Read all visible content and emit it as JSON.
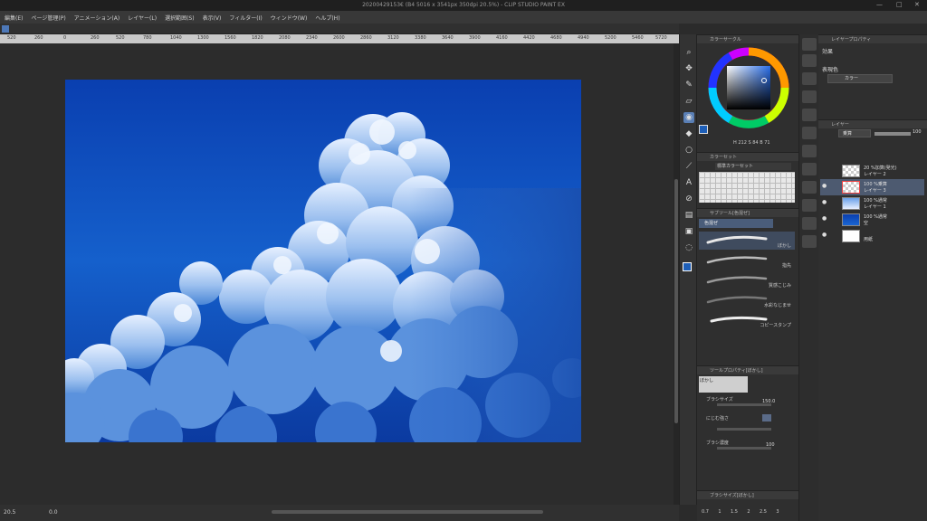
{
  "app": {
    "title": "20200429153€ (B4 5016 x 3541px 350dpi 20.5%) - CLIP STUDIO PAINT EX"
  },
  "window_controls": {
    "minimize": "—",
    "maximize": "□",
    "close": "✕"
  },
  "menu": [
    "編集(E)",
    "ページ管理(P)",
    "アニメーション(A)",
    "レイヤー(L)",
    "選択範囲(S)",
    "表示(V)",
    "フィルター(I)",
    "ウィンドウ(W)",
    "ヘルプ(H)"
  ],
  "ruler": {
    "ticks": [
      "520",
      "260",
      "0",
      "260",
      "520",
      "780",
      "1040",
      "1300",
      "1560",
      "1820",
      "2080",
      "2340",
      "2600",
      "2860",
      "3120",
      "3380",
      "3640",
      "3900",
      "4160",
      "4420",
      "4680",
      "4940",
      "5200",
      "5460",
      "5720"
    ]
  },
  "status": {
    "zoom": "20.5",
    "angle": "0.0"
  },
  "color_wheel": {
    "panel_title": "カラーサークル",
    "readout": "H 212  S 84  B 71",
    "main_color": "#1e5fb8",
    "sub_color": "#ffffff"
  },
  "color_set": {
    "panel_title": "カラーセット",
    "set_name": "標準カラーセット"
  },
  "sub_tool": {
    "panel_title": "サブツール[色混ぜ]",
    "group": "色混ぜ",
    "brushes": [
      "ぼかし",
      "指先",
      "質感こじみ",
      "水彩なじませ",
      "コピースタンプ"
    ]
  },
  "tool_property": {
    "panel_title": "ツールプロパティ[ぼかし]",
    "tool_name": "ぼかし",
    "brush_size_label": "ブラシサイズ",
    "brush_size_value": "150.0",
    "blur_label": "にじむ強さ",
    "density_label": "ブラシ濃度",
    "density_value": "100"
  },
  "brush_size_panel": {
    "panel_title": "ブラシサイズ[ぼかし]",
    "sizes": [
      "0.7",
      "1",
      "1.5",
      "2",
      "2.5",
      "3"
    ]
  },
  "properties": {
    "panel_title": "レイヤープロパティ",
    "effect_label": "効果",
    "expression_label": "表現色",
    "expression_value": "カラー"
  },
  "layers": {
    "panel_title": "レイヤー",
    "blend_mode": "乗算",
    "opacity": "100",
    "items": [
      {
        "line1": "20 %加算(発光)",
        "line2": "レイヤー 2"
      },
      {
        "line1": "100 %乗算",
        "line2": "レイヤー 3"
      },
      {
        "line1": "100 %通常",
        "line2": "レイヤー 1"
      },
      {
        "line1": "100 %通常",
        "line2": "空"
      },
      {
        "line1": "",
        "line2": "用紙"
      }
    ]
  }
}
